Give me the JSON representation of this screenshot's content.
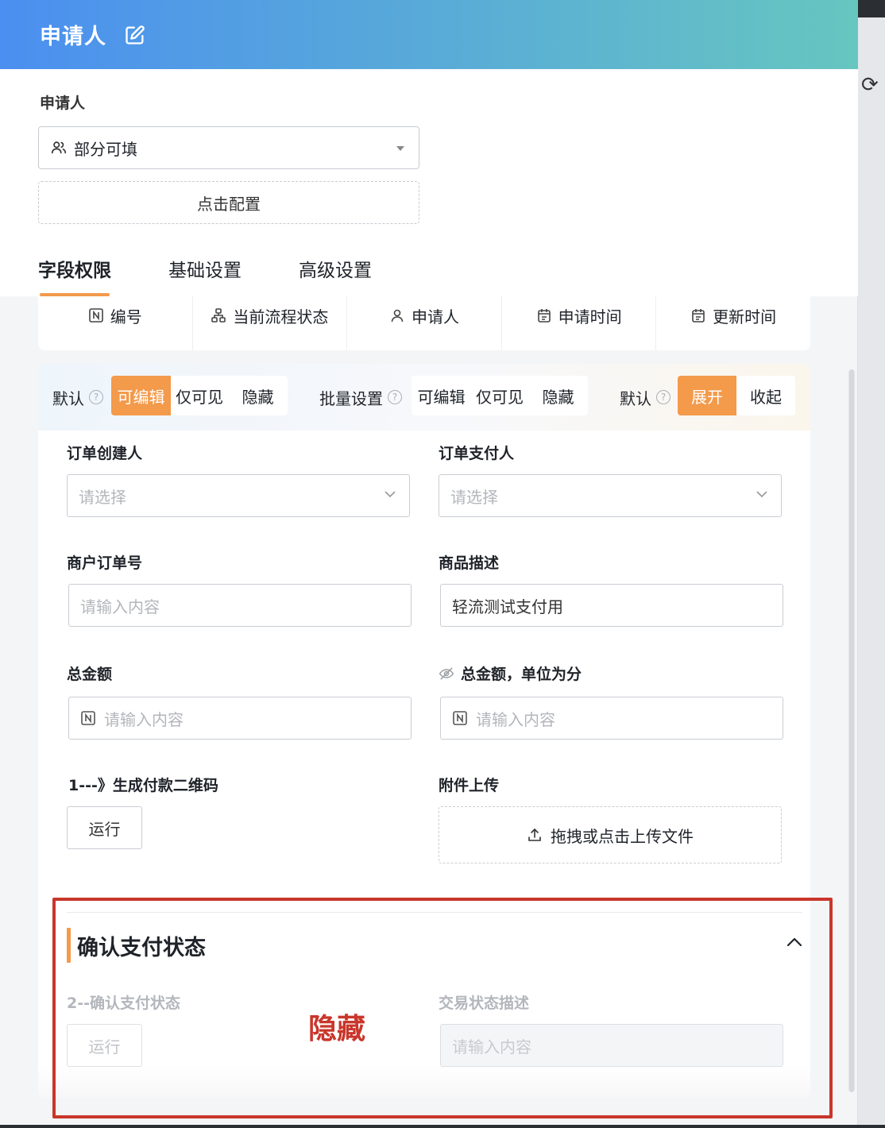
{
  "header": {
    "title": "申请人"
  },
  "applicant": {
    "label": "申请人",
    "select_value": "部分可填",
    "config_button": "点击配置"
  },
  "tabs": [
    {
      "label": "字段权限",
      "active": true
    },
    {
      "label": "基础设置",
      "active": false
    },
    {
      "label": "高级设置",
      "active": false
    }
  ],
  "system_fields": [
    {
      "label": "编号",
      "icon": "number-icon"
    },
    {
      "label": "当前流程状态",
      "icon": "flow-icon"
    },
    {
      "label": "申请人",
      "icon": "user-icon"
    },
    {
      "label": "申请时间",
      "icon": "calendar-icon"
    },
    {
      "label": "更新时间",
      "icon": "calendar-icon"
    }
  ],
  "permission_bar": {
    "default_label": "默认",
    "default_options": [
      "可编辑",
      "仅可见",
      "隐藏"
    ],
    "default_selected": "可编辑",
    "batch_label": "批量设置",
    "batch_options": [
      "可编辑",
      "仅可见",
      "隐藏"
    ],
    "expand_label": "默认",
    "expand_options": [
      "展开",
      "收起"
    ],
    "expand_selected": "展开"
  },
  "form": {
    "order_creator": {
      "label": "订单创建人",
      "placeholder": "请选择"
    },
    "order_payer": {
      "label": "订单支付人",
      "placeholder": "请选择"
    },
    "merchant_order_no": {
      "label": "商户订单号",
      "placeholder": "请输入内容"
    },
    "product_desc": {
      "label": "商品描述",
      "value": "轻流测试支付用"
    },
    "total_amount": {
      "label": "总金额",
      "placeholder": "请输入内容"
    },
    "total_amount_cents": {
      "label": "总金额，单位为分",
      "placeholder": "请输入内容"
    },
    "qr_code": {
      "label": "1---》生成付款二维码",
      "button": "运行"
    },
    "attachment": {
      "label": "附件上传",
      "upload_text": "拖拽或点击上传文件"
    }
  },
  "section": {
    "title": "确认支付状态",
    "confirm": {
      "label": "2--确认支付状态",
      "button": "运行"
    },
    "trade_status": {
      "label": "交易状态描述",
      "placeholder": "请输入内容"
    },
    "annotation": "隐藏"
  },
  "colors": {
    "accent": "#f39a4b",
    "header_start": "#4b8ff0",
    "header_end": "#66c6c0",
    "annotation_red": "#c9362b"
  }
}
